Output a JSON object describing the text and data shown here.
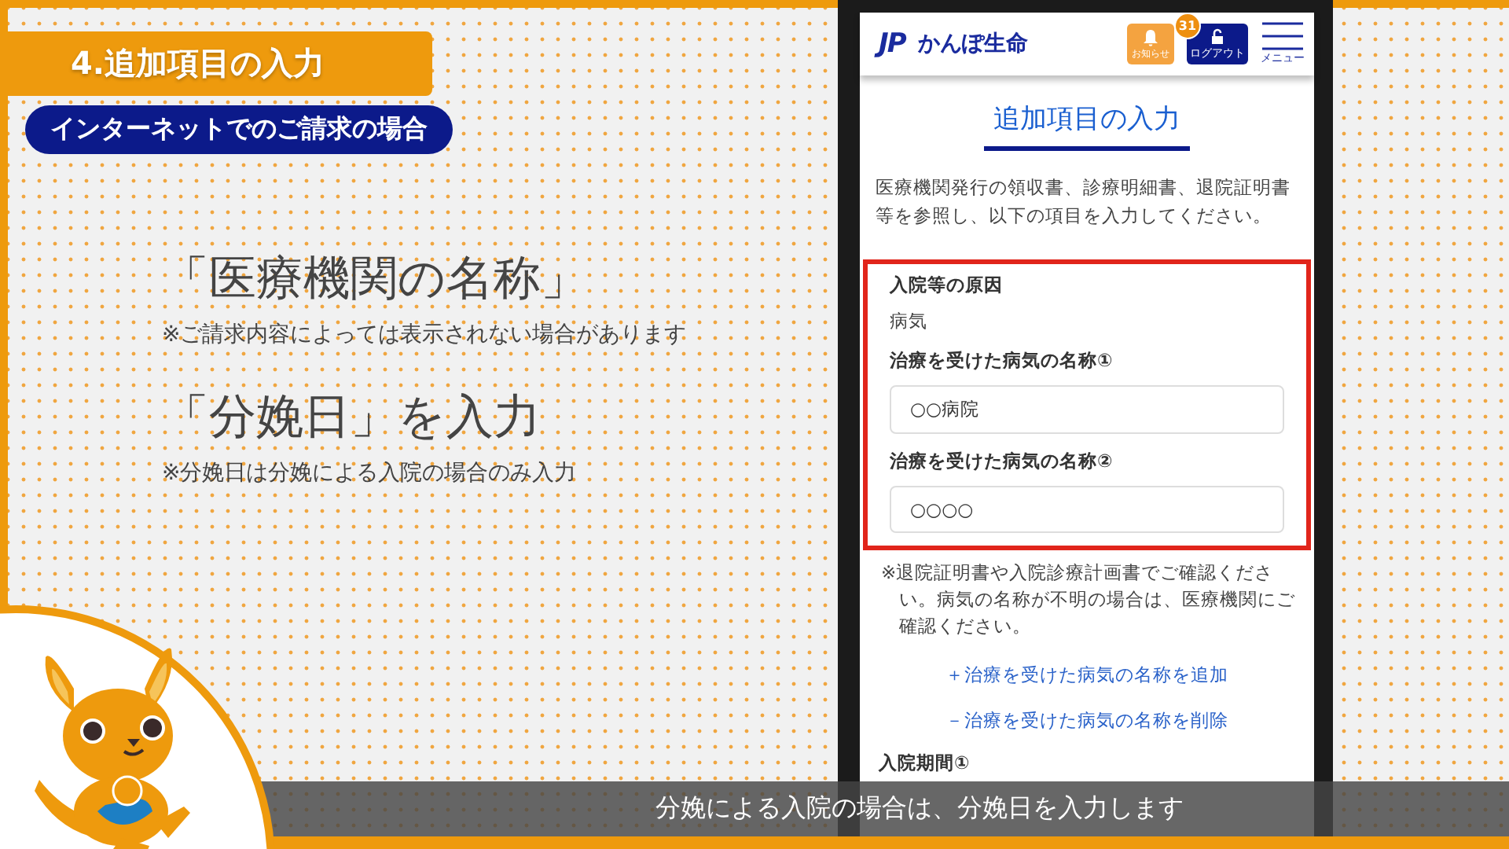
{
  "header": {
    "section_title": "4.追加項目の入力",
    "subsection": "インターネットでのご請求の場合"
  },
  "points": [
    {
      "heading": "「医療機関の名称」",
      "note": "※ご請求内容によっては表示されない場合があります"
    },
    {
      "heading": "「分娩日」を入力",
      "note": "※分娩日は分娩による入院の場合のみ入力"
    }
  ],
  "phone": {
    "logo_text": "JP",
    "brand": "かんぽ生命",
    "notifications": {
      "badge": "31",
      "label": "お知らせ"
    },
    "logout": "ログアウト",
    "menu": "メニュー",
    "page_title": "追加項目の入力",
    "intro": "医療機関発行の領収書、診療明細書、退院証明書等を参照し、以下の項目を入力してください。",
    "section": {
      "highlighted": true,
      "fields": [
        {
          "kind": "static",
          "label": "入院等の原因",
          "value": "病気"
        },
        {
          "kind": "input",
          "label": "治療を受けた病気の名称①",
          "value": "○○病院"
        },
        {
          "kind": "input",
          "label": "治療を受けた病気の名称②",
          "value": "○○○○"
        }
      ]
    },
    "note": "※退院証明書や入院診療計画書でご確認ください。病気の名称が不明の場合は、医療機関にご確認ください。",
    "links": [
      {
        "label": "＋治療を受けた病気の名称を追加"
      },
      {
        "label": "－治療を受けた病気の名称を削除"
      }
    ],
    "next_label": "入院期間①"
  },
  "subtitle": "分娩による入院の場合は、分娩日を入力します"
}
